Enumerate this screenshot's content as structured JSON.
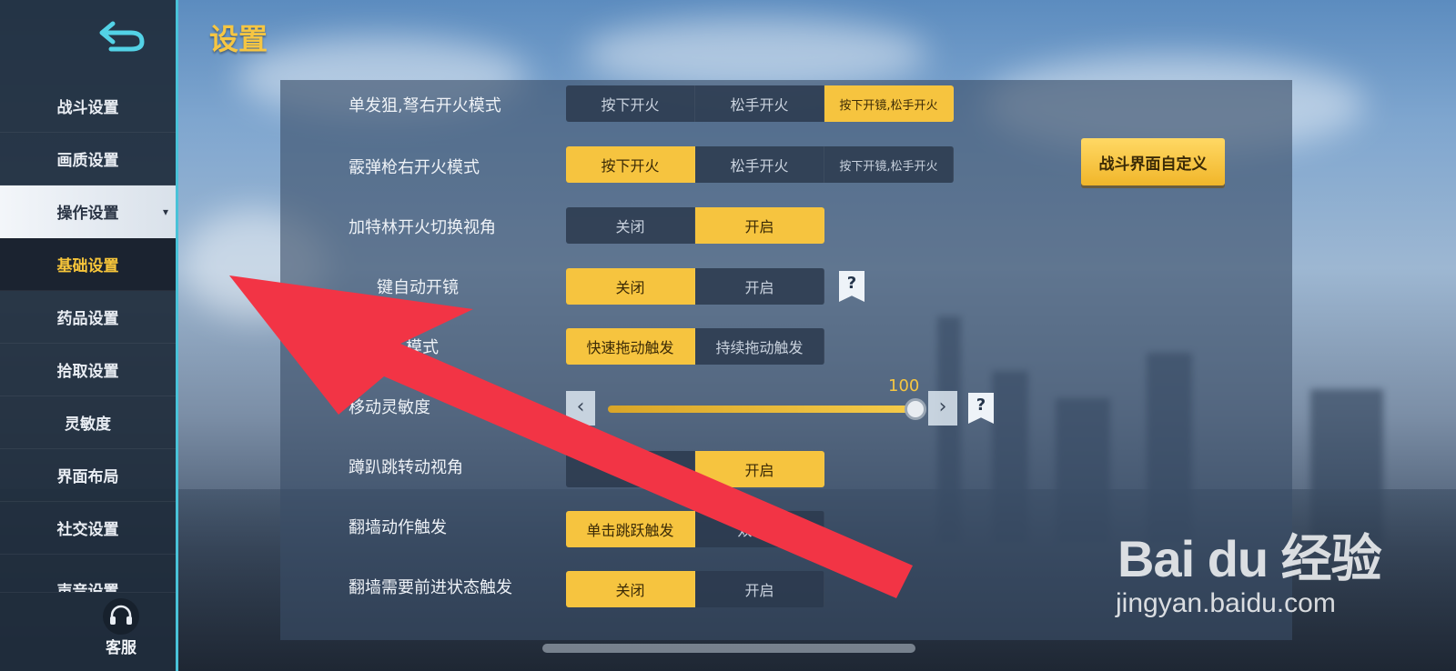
{
  "page": {
    "title": "设置"
  },
  "sidebar": {
    "items": [
      {
        "label": "战斗设置"
      },
      {
        "label": "画质设置"
      },
      {
        "label": "操作设置",
        "caret": "▾"
      },
      {
        "label": "基础设置"
      },
      {
        "label": "药品设置"
      },
      {
        "label": "拾取设置"
      },
      {
        "label": "灵敏度"
      },
      {
        "label": "界面布局"
      },
      {
        "label": "社交设置"
      },
      {
        "label": "声音设置"
      }
    ],
    "customer_service": {
      "label": "客服",
      "icon": "headset-icon"
    },
    "back_icon": "back-arrow-icon"
  },
  "settings": {
    "rows": [
      {
        "label": "单发狙,弩右开火模式",
        "options": [
          "按下开火",
          "松手开火",
          "按下开镜,松手开火"
        ],
        "selected": 2
      },
      {
        "label": "霰弹枪右开火模式",
        "options": [
          "按下开火",
          "松手开火",
          "按下开镜,松手开火"
        ],
        "selected": 0
      },
      {
        "label": "加特林开火切换视角",
        "options": [
          "关闭",
          "开启"
        ],
        "selected": 1
      },
      {
        "label": "键自动开镜",
        "options": [
          "关闭",
          "开启"
        ],
        "selected": 0
      },
      {
        "label": "模式",
        "options": [
          "快速拖动触发",
          "持续拖动触发"
        ],
        "selected": 0
      },
      {
        "label": "移动灵敏度",
        "slider_value": "100"
      },
      {
        "label": "蹲趴跳转动视角",
        "options": [
          "关",
          "开启"
        ],
        "selected": 1
      },
      {
        "label": "翻墙动作触发",
        "options": [
          "单击跳跃触发",
          "双击跳"
        ],
        "selected": 0
      },
      {
        "label": "翻墙需要前进状态触发",
        "options": [
          "关闭",
          "开启"
        ],
        "selected": 0
      }
    ],
    "help_label": "?",
    "slider_left": "‹",
    "slider_right": "›",
    "custom_button": "战斗界面自定义"
  },
  "colors": {
    "accent": "#f6c43f",
    "sidebar_border": "#49c2d8",
    "annotation_arrow": "#f23445"
  },
  "watermark": {
    "logo": "Bai du 经验",
    "url": "jingyan.baidu.com"
  }
}
